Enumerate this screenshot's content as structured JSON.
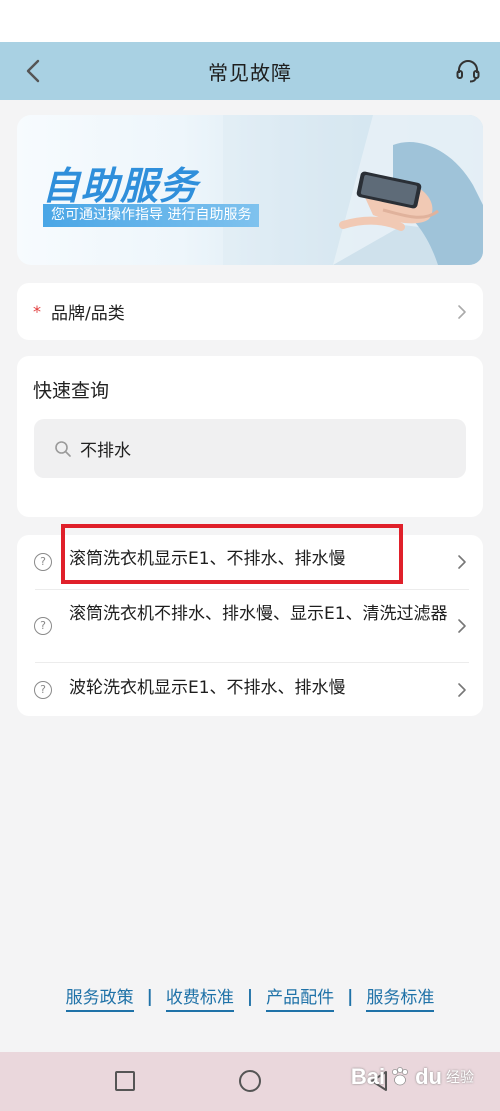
{
  "header": {
    "title": "常见故障",
    "back_icon": "chevron-left-icon",
    "service_icon": "headset-icon"
  },
  "banner": {
    "title": "自助服务",
    "subtitle": "您可通过操作指导  进行自助服务"
  },
  "brand_row": {
    "required_mark": "*",
    "label": "品牌/品类"
  },
  "quick_query": {
    "title": "快速查询",
    "search_value": "不排水"
  },
  "results": [
    {
      "icon": "?",
      "text": "滚筒洗衣机显示E1、不排水、排水慢"
    },
    {
      "icon": "?",
      "text": "滚筒洗衣机不排水、排水慢、显示E1、清洗过滤器"
    },
    {
      "icon": "?",
      "text": "波轮洗衣机显示E1、不排水、排水慢"
    }
  ],
  "footer": {
    "links": [
      "服务政策",
      "收费标准",
      "产品配件",
      "服务标准"
    ],
    "separator": "|"
  },
  "watermark": {
    "brand": "Bai",
    "brand2": "du",
    "sub": "经验"
  },
  "colors": {
    "nav_bar": "#a9d1e3",
    "banner_accent": "#2f8fdb",
    "link": "#1f72a8",
    "highlight": "#e0202a",
    "required": "#e23b3b"
  }
}
